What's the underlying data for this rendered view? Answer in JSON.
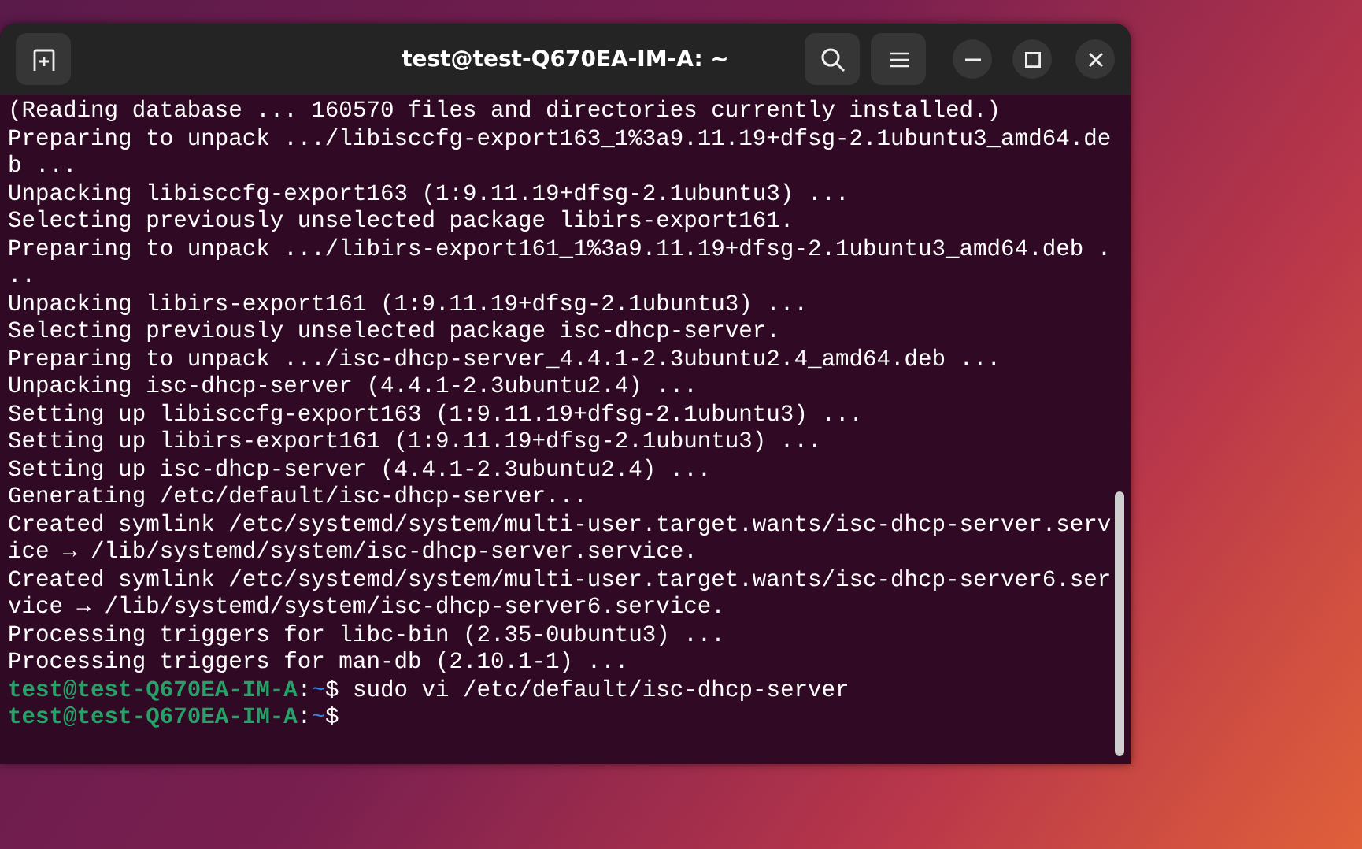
{
  "window": {
    "title": "test@test-Q670EA-IM-A: ~"
  },
  "terminal": {
    "lines": [
      {
        "kind": "output",
        "text": "(Reading database ... 160570 files and directories currently installed.)"
      },
      {
        "kind": "output",
        "text": "Preparing to unpack .../libisccfg-export163_1%3a9.11.19+dfsg-2.1ubuntu3_amd64.de"
      },
      {
        "kind": "output",
        "text": "b ..."
      },
      {
        "kind": "output",
        "text": "Unpacking libisccfg-export163 (1:9.11.19+dfsg-2.1ubuntu3) ..."
      },
      {
        "kind": "output",
        "text": "Selecting previously unselected package libirs-export161."
      },
      {
        "kind": "output",
        "text": "Preparing to unpack .../libirs-export161_1%3a9.11.19+dfsg-2.1ubuntu3_amd64.deb ."
      },
      {
        "kind": "output",
        "text": ".."
      },
      {
        "kind": "output",
        "text": "Unpacking libirs-export161 (1:9.11.19+dfsg-2.1ubuntu3) ..."
      },
      {
        "kind": "output",
        "text": "Selecting previously unselected package isc-dhcp-server."
      },
      {
        "kind": "output",
        "text": "Preparing to unpack .../isc-dhcp-server_4.4.1-2.3ubuntu2.4_amd64.deb ..."
      },
      {
        "kind": "output",
        "text": "Unpacking isc-dhcp-server (4.4.1-2.3ubuntu2.4) ..."
      },
      {
        "kind": "output",
        "text": "Setting up libisccfg-export163 (1:9.11.19+dfsg-2.1ubuntu3) ..."
      },
      {
        "kind": "output",
        "text": "Setting up libirs-export161 (1:9.11.19+dfsg-2.1ubuntu3) ..."
      },
      {
        "kind": "output",
        "text": "Setting up isc-dhcp-server (4.4.1-2.3ubuntu2.4) ..."
      },
      {
        "kind": "output",
        "text": "Generating /etc/default/isc-dhcp-server..."
      },
      {
        "kind": "output",
        "text": "Created symlink /etc/systemd/system/multi-user.target.wants/isc-dhcp-server.serv"
      },
      {
        "kind": "output",
        "text": "ice → /lib/systemd/system/isc-dhcp-server.service."
      },
      {
        "kind": "output",
        "text": "Created symlink /etc/systemd/system/multi-user.target.wants/isc-dhcp-server6.ser"
      },
      {
        "kind": "output",
        "text": "vice → /lib/systemd/system/isc-dhcp-server6.service."
      },
      {
        "kind": "output",
        "text": "Processing triggers for libc-bin (2.35-0ubuntu3) ..."
      },
      {
        "kind": "output",
        "text": "Processing triggers for man-db (2.10.1-1) ..."
      },
      {
        "kind": "prompt",
        "user": "test@test-Q670EA-IM-A",
        "separator": ":",
        "path": "~",
        "symbol": "$",
        "command": "sudo vi /etc/default/isc-dhcp-server"
      },
      {
        "kind": "prompt",
        "user": "test@test-Q670EA-IM-A",
        "separator": ":",
        "path": "~",
        "symbol": "$"
      }
    ]
  }
}
